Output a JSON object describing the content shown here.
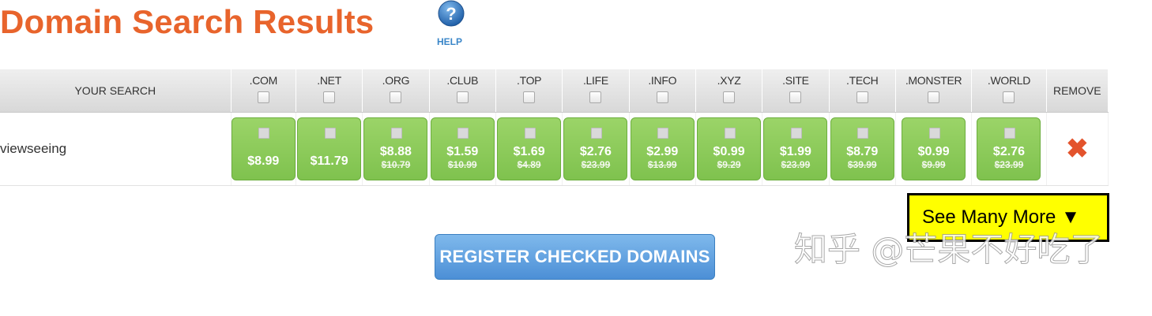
{
  "page": {
    "title": "Domain Search Results",
    "help_label": "HELP",
    "colors": {
      "title": "#e8642c",
      "price_bg": "#8cc85a",
      "register_bg": "#5a9ee0",
      "remove_icon": "#e3532c",
      "see_more_bg": "#ffff00"
    }
  },
  "table": {
    "search_header": "YOUR SEARCH",
    "remove_header": "REMOVE",
    "tlds": [
      ".COM",
      ".NET",
      ".ORG",
      ".CLUB",
      ".TOP",
      ".LIFE",
      ".INFO",
      ".XYZ",
      ".SITE",
      ".TECH",
      ".MONSTER",
      ".WORLD"
    ],
    "row": {
      "search_term": "viewseeing",
      "prices": [
        {
          "price": "$8.99",
          "old": ""
        },
        {
          "price": "$11.79",
          "old": ""
        },
        {
          "price": "$8.88",
          "old": "$10.79"
        },
        {
          "price": "$1.59",
          "old": "$10.99"
        },
        {
          "price": "$1.69",
          "old": "$4.89"
        },
        {
          "price": "$2.76",
          "old": "$23.99"
        },
        {
          "price": "$2.99",
          "old": "$13.99"
        },
        {
          "price": "$0.99",
          "old": "$9.29"
        },
        {
          "price": "$1.99",
          "old": "$23.99"
        },
        {
          "price": "$8.79",
          "old": "$39.99"
        },
        {
          "price": "$0.99",
          "old": "$9.99"
        },
        {
          "price": "$2.76",
          "old": "$23.99"
        }
      ],
      "remove_icon": "close-x-icon"
    }
  },
  "actions": {
    "see_more_label": "See Many More ▼",
    "register_label": "REGISTER CHECKED DOMAINS"
  },
  "watermark": "知乎 @芒果不好吃了"
}
